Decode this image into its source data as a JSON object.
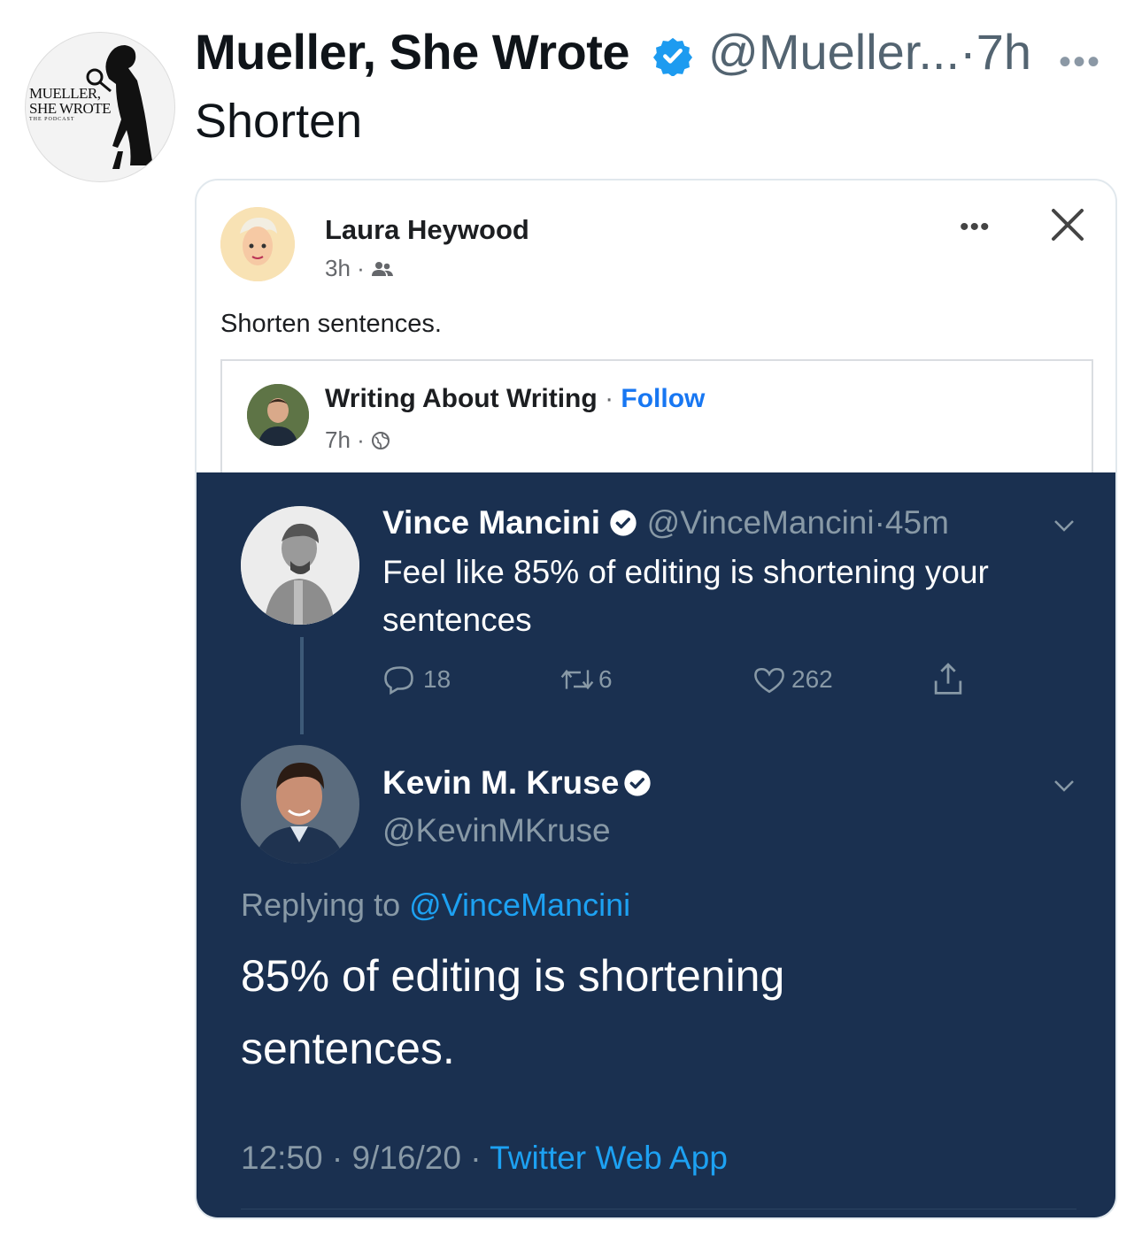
{
  "tweet": {
    "author_name": "Mueller, She Wrote",
    "author_handle": "@Mueller...",
    "separator": "·",
    "time": "7h",
    "text": "Shorten",
    "avatar_logo_text": [
      "MUELLER,",
      "SHE WROTE",
      "THE PODCAST"
    ]
  },
  "facebook_post": {
    "author": "Laura Heywood",
    "time": "3h",
    "separator": "·",
    "text": "Shorten sentences.",
    "shared": {
      "page_name": "Writing About Writing",
      "separator": "·",
      "follow_label": "Follow",
      "time": "7h"
    }
  },
  "screenshot": {
    "original": {
      "name": "Vince Mancini",
      "handle": "@VinceMancini",
      "separator": "·",
      "time": "45m",
      "text_line1": "Feel like 85% of editing is shortening your",
      "text_line2": "sentences",
      "replies": "18",
      "retweets": "6",
      "likes": "262"
    },
    "reply": {
      "name": "Kevin M. Kruse",
      "handle": "@KevinMKruse",
      "replying_prefix": "Replying to",
      "replying_handle": "@VinceMancini",
      "text_line1": "85% of editing is shortening",
      "text_line2": "sentences.",
      "time": "12:50",
      "date": "9/16/20",
      "separator": "·",
      "source": "Twitter Web App"
    }
  },
  "colors": {
    "dark_bg": "#1a3050",
    "twitter_blue": "#1da1f2",
    "fb_link_blue": "#1877f2",
    "verified_blue": "#1d9bf0"
  }
}
